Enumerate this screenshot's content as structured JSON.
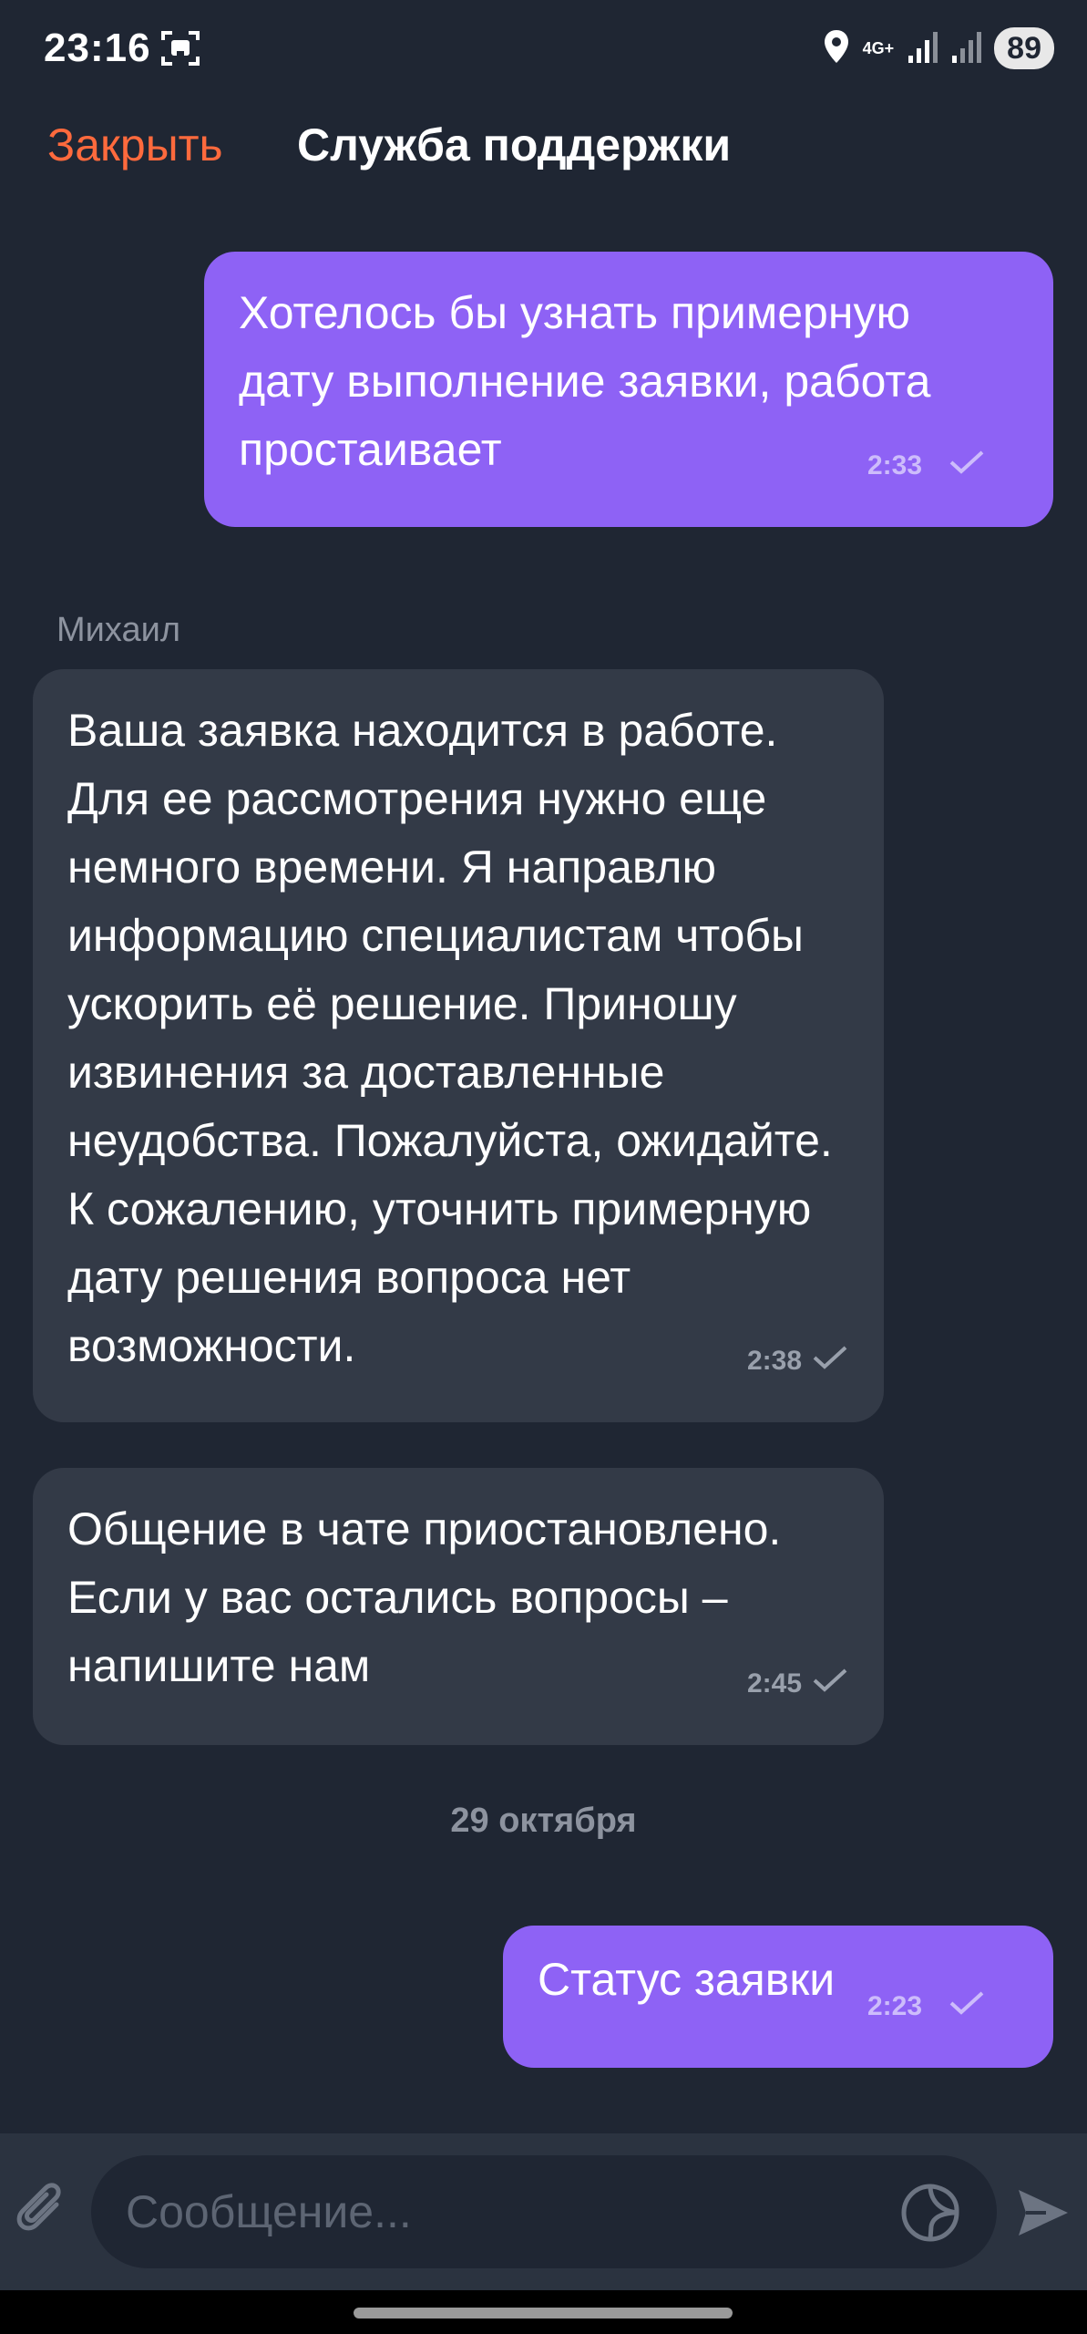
{
  "status_bar": {
    "time": "23:16",
    "network": "4G+",
    "battery": "89",
    "icons": [
      "screenshot-icon",
      "location-icon",
      "signal-icon",
      "signal-icon"
    ]
  },
  "header": {
    "close_label": "Закрыть",
    "title": "Служба поддержки"
  },
  "messages": [
    {
      "direction": "out",
      "text": "Хотелось бы узнать примерную\nдату выполнение заявки, работа\nпростаивает",
      "time": "2:33",
      "status_icon": "check-icon"
    },
    {
      "direction": "in",
      "sender": "Михаил",
      "text": "Ваша заявка находится в работе.\nДля ее рассмотрения нужно еще\nнемного времени. Я направлю\nинформацию специалистам чтобы\nускорить её решение. Приношу\nизвинения за доставленные\nнеудобства. Пожалуйста, ожидайте.\nК сожалению, уточнить примерную\nдату решения вопроса нет\nвозможности.",
      "time": "2:38",
      "status_icon": "check-icon"
    },
    {
      "direction": "in",
      "text": "Общение в чате приостановлено.\nЕсли у вас остались вопросы –\nнапишите нам",
      "time": "2:45",
      "status_icon": "check-icon"
    },
    {
      "direction": "out",
      "text": "Статус заявки",
      "time": "2:23",
      "status_icon": "check-icon"
    }
  ],
  "date_divider": "29 октября",
  "composer": {
    "placeholder": "Сообщение...",
    "value": "",
    "icons": [
      "attach-icon",
      "sticker-icon",
      "send-icon"
    ]
  },
  "colors": {
    "background": "#1f2633",
    "accent_close": "#ff6a3d",
    "outgoing_bubble": "#8e62f5",
    "incoming_bubble": "#333a47",
    "composer_bar": "#2b3340"
  }
}
